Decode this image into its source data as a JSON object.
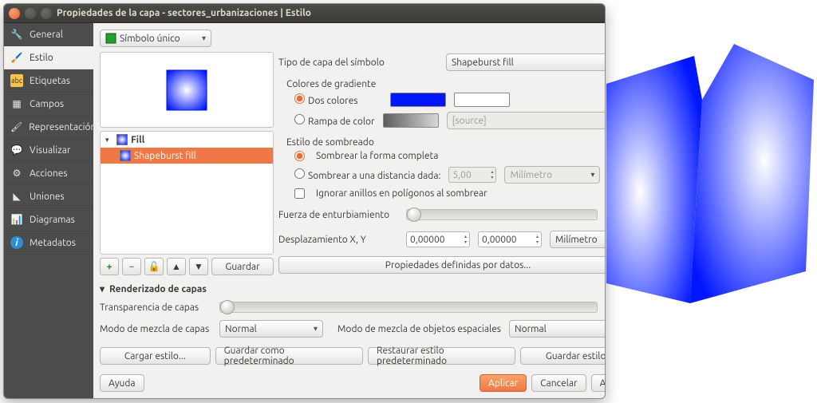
{
  "title": "Propiedades de la capa - sectores_urbanizaciones | Estilo",
  "sidebar": {
    "items": [
      {
        "label": "General"
      },
      {
        "label": "Estilo"
      },
      {
        "label": "Etiquetas"
      },
      {
        "label": "Campos"
      },
      {
        "label": "Representación"
      },
      {
        "label": "Visualizar"
      },
      {
        "label": "Acciones"
      },
      {
        "label": "Uniones"
      },
      {
        "label": "Diagramas"
      },
      {
        "label": "Metadatos"
      }
    ],
    "active": 1
  },
  "symbol_combo": "Símbolo único",
  "tree": {
    "parent": "Fill",
    "child": "Shapeburst fill"
  },
  "save_btn": "Guardar",
  "labels": {
    "symbol_layer_type": "Tipo de capa del símbolo",
    "gradient_colors": "Colores de gradiente",
    "two_colors": "Dos colores",
    "color_ramp": "Rampa de color",
    "ramp_source": "[source]",
    "shade_style": "Estilo de sombreado",
    "shade_whole": "Sombrear la forma completa",
    "shade_dist": "Sombrear a una distancia dada:",
    "ignore_rings": "Ignorar anillos en polígonos al sombrear",
    "blur": "Fuerza de enturbiamiento",
    "offset": "Desplazamiento X, Y",
    "data_defined": "Propiedades definidas por datos...",
    "layer_rendering": "Renderizado de capas",
    "layer_transparency": "Transparencia de capas",
    "layer_blend": "Modo de mezcla de capas",
    "feature_blend": "Modo de mezcla de objetos espaciales"
  },
  "values": {
    "symbol_type": "Shapeburst fill",
    "shade_dist_val": "5,00",
    "shade_dist_unit": "Milímetro",
    "blur": "0",
    "offx": "0,00000",
    "offy": "0,00000",
    "offset_unit": "Milímetro",
    "transparency": "0",
    "blend_mode": "Normal"
  },
  "buttons": {
    "load_style": "Cargar estilo...",
    "save_default": "Guardar como predeterminado",
    "restore_default": "Restaurar estilo predeterminado",
    "save_style": "Guardar estilo",
    "help": "Ayuda",
    "apply": "Aplicar",
    "cancel": "Cancelar",
    "ok": "Aceptar"
  },
  "colors": {
    "color1": "#0016ff",
    "color2": "#ffffff",
    "accent": "#ea6d36"
  }
}
